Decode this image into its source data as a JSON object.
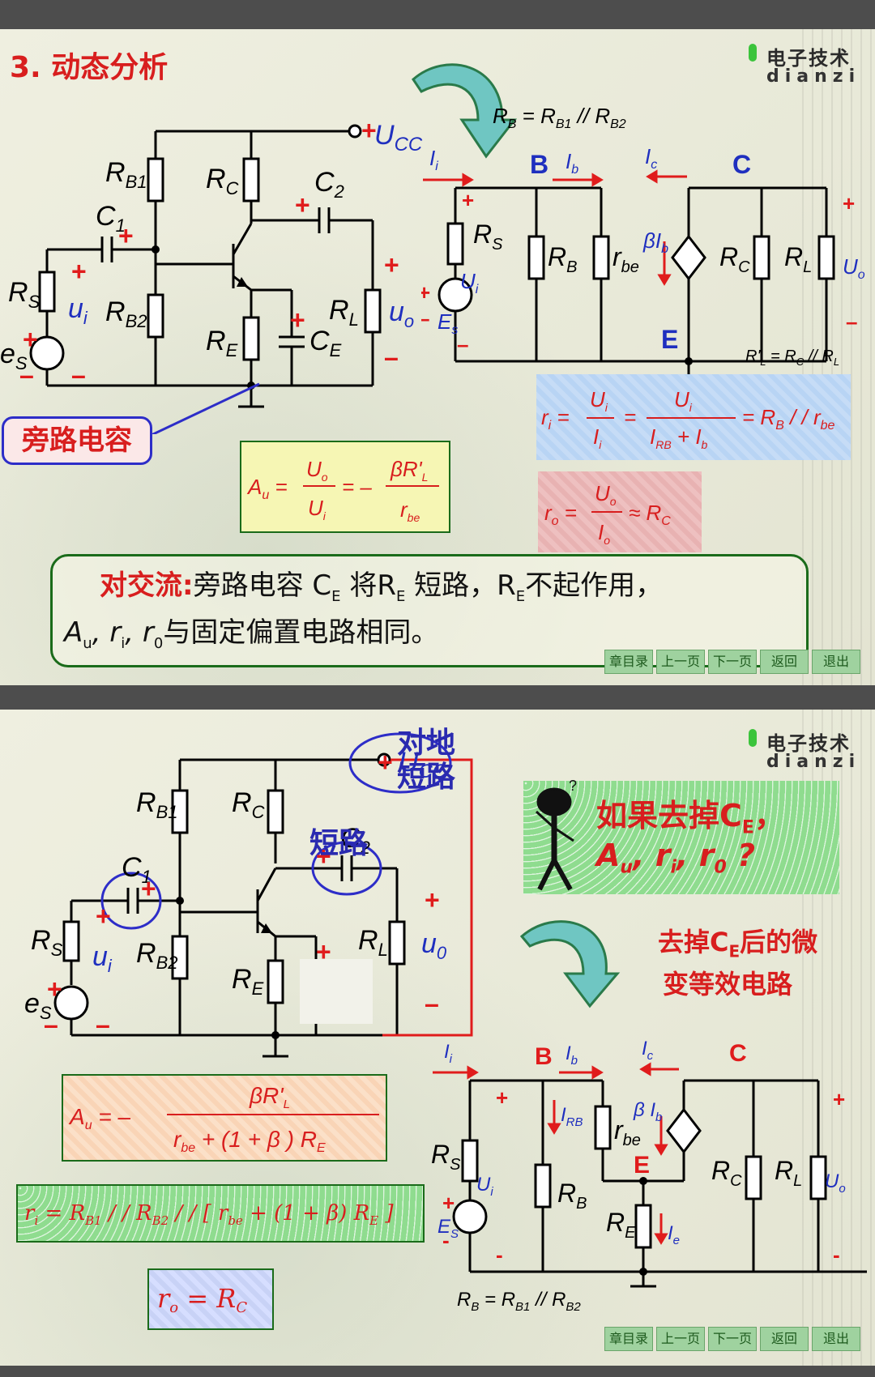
{
  "logo": {
    "cn": "电子技术",
    "en": "dianzi"
  },
  "nav": {
    "toc": "章目录",
    "prev": "上一页",
    "next": "下一页",
    "back": "返回",
    "exit": "退出"
  },
  "slide1": {
    "heading": "3. 动态分析",
    "bypass_label": "旁路电容",
    "note": {
      "prefix": "对交流:",
      "line1_rest": "旁路电容 C",
      "line1_mid": "将R",
      "line1_mid2": "短路，R",
      "line1_end": "不起作用，",
      "line2_a": "A",
      "line2_b": ", r",
      "line2_c": ", r",
      "line2_d": "与固定偏置电路相同。"
    }
  },
  "slide2": {
    "question_l1": "如果去掉C",
    "question_l1_end": "，",
    "question_l2": "A",
    "question_l2_b": ", r",
    "question_l2_c": ", r",
    "question_l2_end": " ?",
    "desc_l1": "去掉C",
    "desc_l1_end": "后的微",
    "desc_l2": "变等效电路",
    "ground_short": [
      "对地",
      "短路"
    ],
    "short_label": "短路"
  }
}
